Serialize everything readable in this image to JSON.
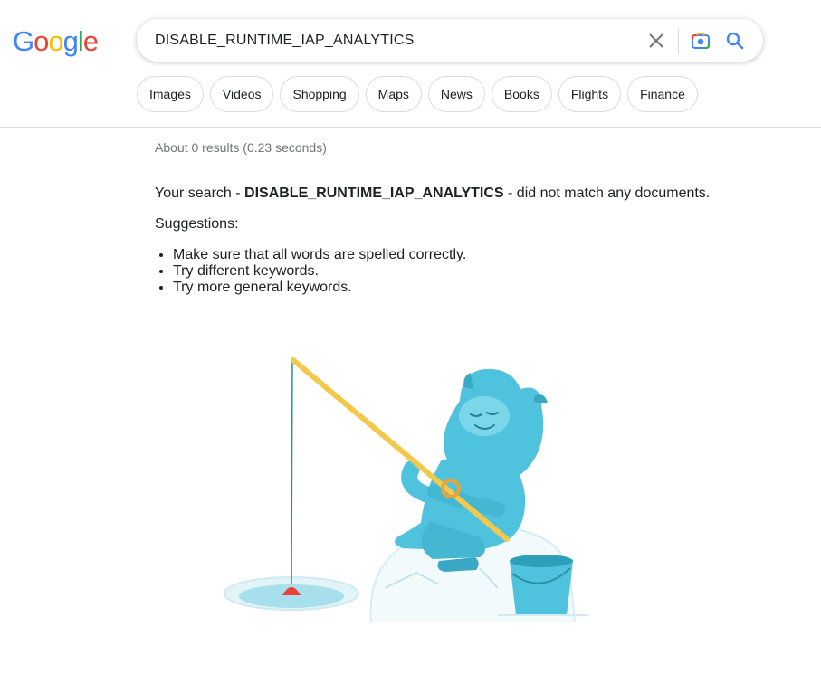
{
  "logo": {
    "letters": [
      "G",
      "o",
      "o",
      "g",
      "l",
      "e"
    ],
    "colors": [
      "#4285F4",
      "#EA4335",
      "#FBBC05",
      "#4285F4",
      "#34A853",
      "#EA4335"
    ]
  },
  "search": {
    "query": "DISABLE_RUNTIME_IAP_ANALYTICS"
  },
  "tabs": [
    {
      "label": "Images"
    },
    {
      "label": "Videos"
    },
    {
      "label": "Shopping"
    },
    {
      "label": "Maps"
    },
    {
      "label": "News"
    },
    {
      "label": "Books"
    },
    {
      "label": "Flights"
    },
    {
      "label": "Finance"
    }
  ],
  "result_stats": "About 0 results (0.23 seconds)",
  "no_results": {
    "prefix": "Your search - ",
    "query": "DISABLE_RUNTIME_IAP_ANALYTICS",
    "suffix": " - did not match any documents."
  },
  "suggestions": {
    "title": "Suggestions:",
    "items": [
      "Make sure that all words are spelled correctly.",
      "Try different keywords.",
      "Try more general keywords."
    ]
  },
  "icons": {
    "clear": "close-icon",
    "lens": "camera-lens-icon",
    "search": "search-icon"
  },
  "colors": {
    "accent_blue": "#4285F4",
    "yeti": "#4FC3DD",
    "rod": "#F2C94C",
    "bobber": "#EA4335"
  }
}
